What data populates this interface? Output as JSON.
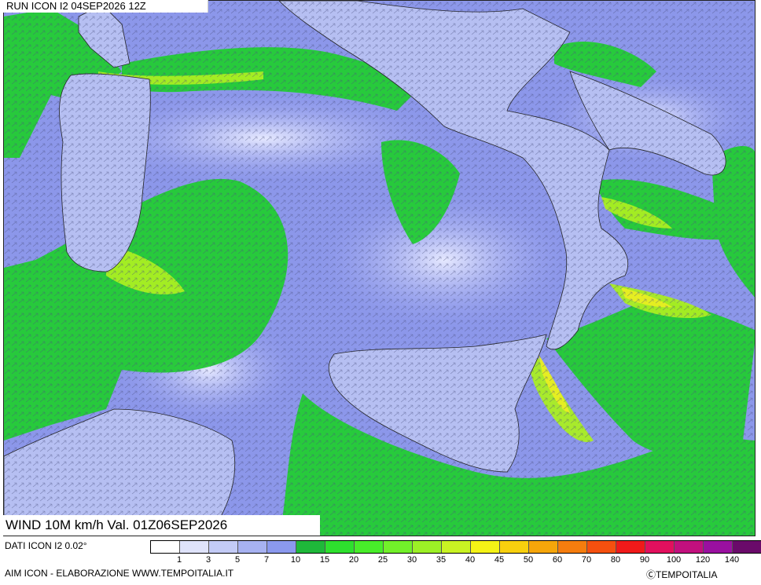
{
  "header": {
    "run_label": "RUN ICON I2 04SEP2026 12Z"
  },
  "map": {
    "title": "WIND 10M km/h Val. 01Z06SEP2026",
    "colors": {
      "sea_calm": "#8c97ea",
      "land": "#b8c1f2",
      "moderate": "#22cc33",
      "strong": "#88ee22",
      "very_strong": "#e6ee22",
      "arrow": "#556"
    }
  },
  "footer": {
    "dati": "DATI ICON I2 0.02°",
    "aim": "AIM ICON - ELABORAZIONE WWW.TEMPOITALIA.IT",
    "copyright": "ⒸTEMPOITALIA"
  },
  "legend": {
    "colors": [
      "#ffffff",
      "#dfe3fb",
      "#c3cbf6",
      "#a7b2f1",
      "#8b99ee",
      "#1fb83a",
      "#2ee02e",
      "#48ed2a",
      "#72f02a",
      "#9cf026",
      "#c9f323",
      "#f5f316",
      "#f8d00e",
      "#f6a60a",
      "#f57d0e",
      "#f5500f",
      "#f01a1a",
      "#e2105e",
      "#c2107e",
      "#9a10a0",
      "#6a0a6a"
    ],
    "ticks": [
      "1",
      "3",
      "5",
      "7",
      "10",
      "15",
      "20",
      "25",
      "30",
      "35",
      "40",
      "45",
      "50",
      "60",
      "70",
      "80",
      "90",
      "100",
      "120",
      "140"
    ]
  }
}
